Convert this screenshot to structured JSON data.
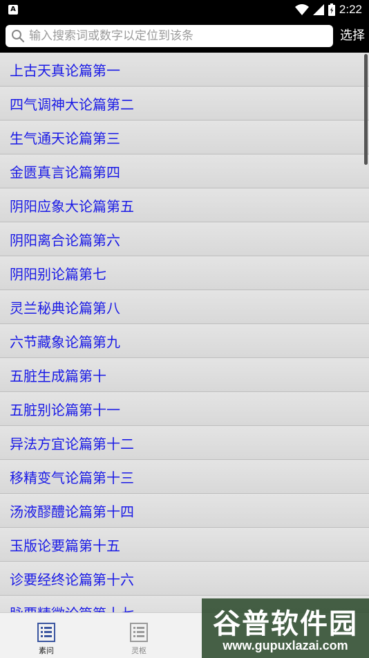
{
  "status_bar": {
    "app_icon_label": "A",
    "time": "2:22"
  },
  "search": {
    "placeholder": "输入搜索词或数字以定位到该条",
    "select_label": "选择"
  },
  "chapters": [
    "上古天真论篇第一",
    "四气调神大论篇第二",
    "生气通天论篇第三",
    "金匮真言论篇第四",
    "阴阳应象大论篇第五",
    "阴阳离合论篇第六",
    "阴阳别论篇第七",
    "灵兰秘典论篇第八",
    "六节藏象论篇第九",
    "五脏生成篇第十",
    "五脏别论篇第十一",
    "异法方宜论篇第十二",
    "移精变气论篇第十三",
    "汤液醪醴论篇第十四",
    "玉版论要篇第十五",
    "诊要经终论篇第十六",
    "脉要精微论篇第十七"
  ],
  "bottom_nav": {
    "tabs": [
      {
        "label": "素问",
        "active": true
      },
      {
        "label": "灵枢",
        "active": false
      }
    ]
  },
  "watermark": {
    "title": "谷普软件园",
    "url": "www.gupuxlazai.com"
  },
  "colors": {
    "link_blue": "#1a1ae6",
    "row_bg": "#dedede",
    "bar_bg": "#000000"
  }
}
